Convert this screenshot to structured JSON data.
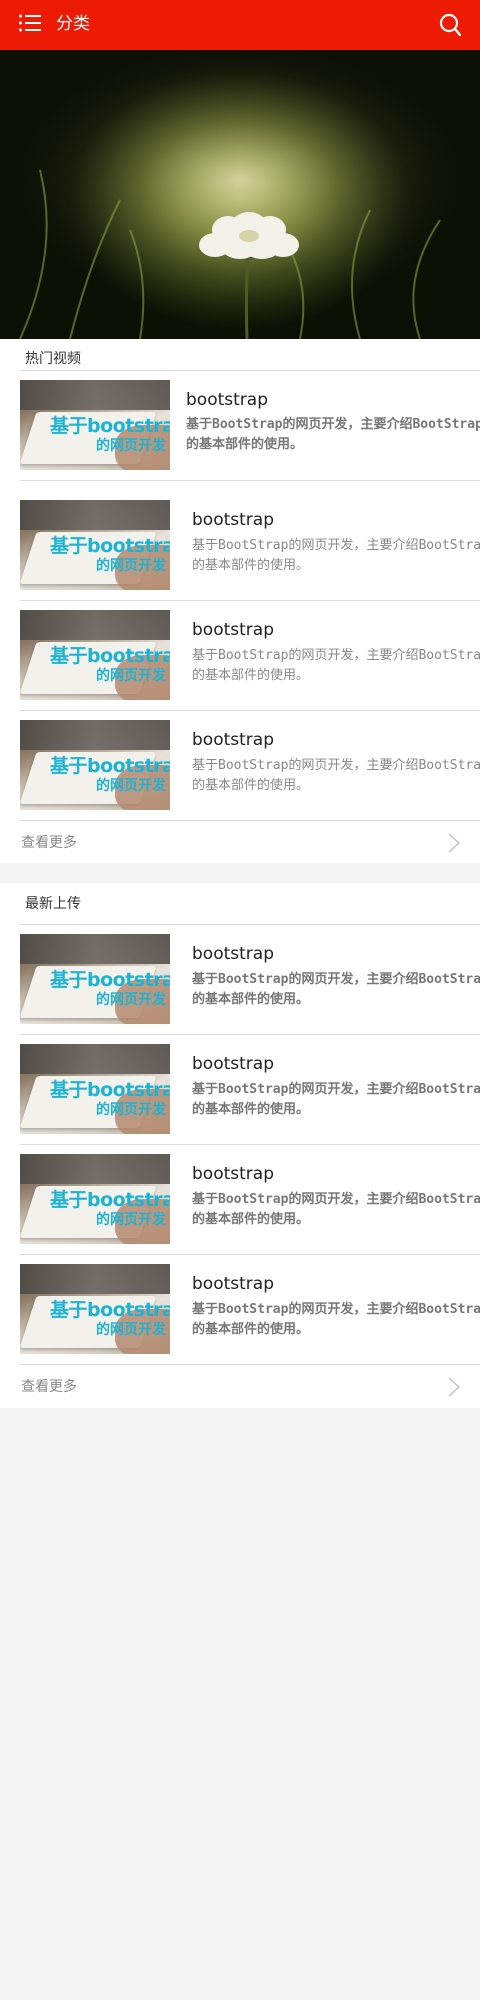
{
  "header": {
    "title": "分类",
    "menu_icon": "list-menu-icon",
    "search_icon": "search-icon",
    "accent": "#ee1b04"
  },
  "hero": {
    "alt": "flower banner"
  },
  "hot": {
    "title": "热门视频",
    "items": [
      {
        "title": "bootstrap",
        "desc": "基于BootStrap的网页开发，主要介绍BootStrap的基本部件的使用。"
      },
      {
        "title": "bootstrap",
        "desc": "基于BootStrap的网页开发，主要介绍BootStrap的基本部件的使用。"
      },
      {
        "title": "bootstrap",
        "desc": "基于BootStrap的网页开发，主要介绍BootStrap的基本部件的使用。"
      },
      {
        "title": "bootstrap",
        "desc": "基于BootStrap的网页开发，主要介绍BootStrap的基本部件的使用。"
      }
    ],
    "more": "查看更多"
  },
  "latest": {
    "title": "最新上传",
    "items": [
      {
        "title": "bootstrap",
        "desc": "基于BootStrap的网页开发，主要介绍BootStrap的基本部件的使用。"
      },
      {
        "title": "bootstrap",
        "desc": "基于BootStrap的网页开发，主要介绍BootStrap的基本部件的使用。"
      },
      {
        "title": "bootstrap",
        "desc": "基于BootStrap的网页开发，主要介绍BootStrap的基本部件的使用。"
      },
      {
        "title": "bootstrap",
        "desc": "基于BootStrap的网页开发，主要介绍BootStrap的基本部件的使用。"
      }
    ],
    "more": "查看更多"
  },
  "thumbnail": {
    "line1": "基于bootstrap",
    "line2": "的网页开发"
  }
}
